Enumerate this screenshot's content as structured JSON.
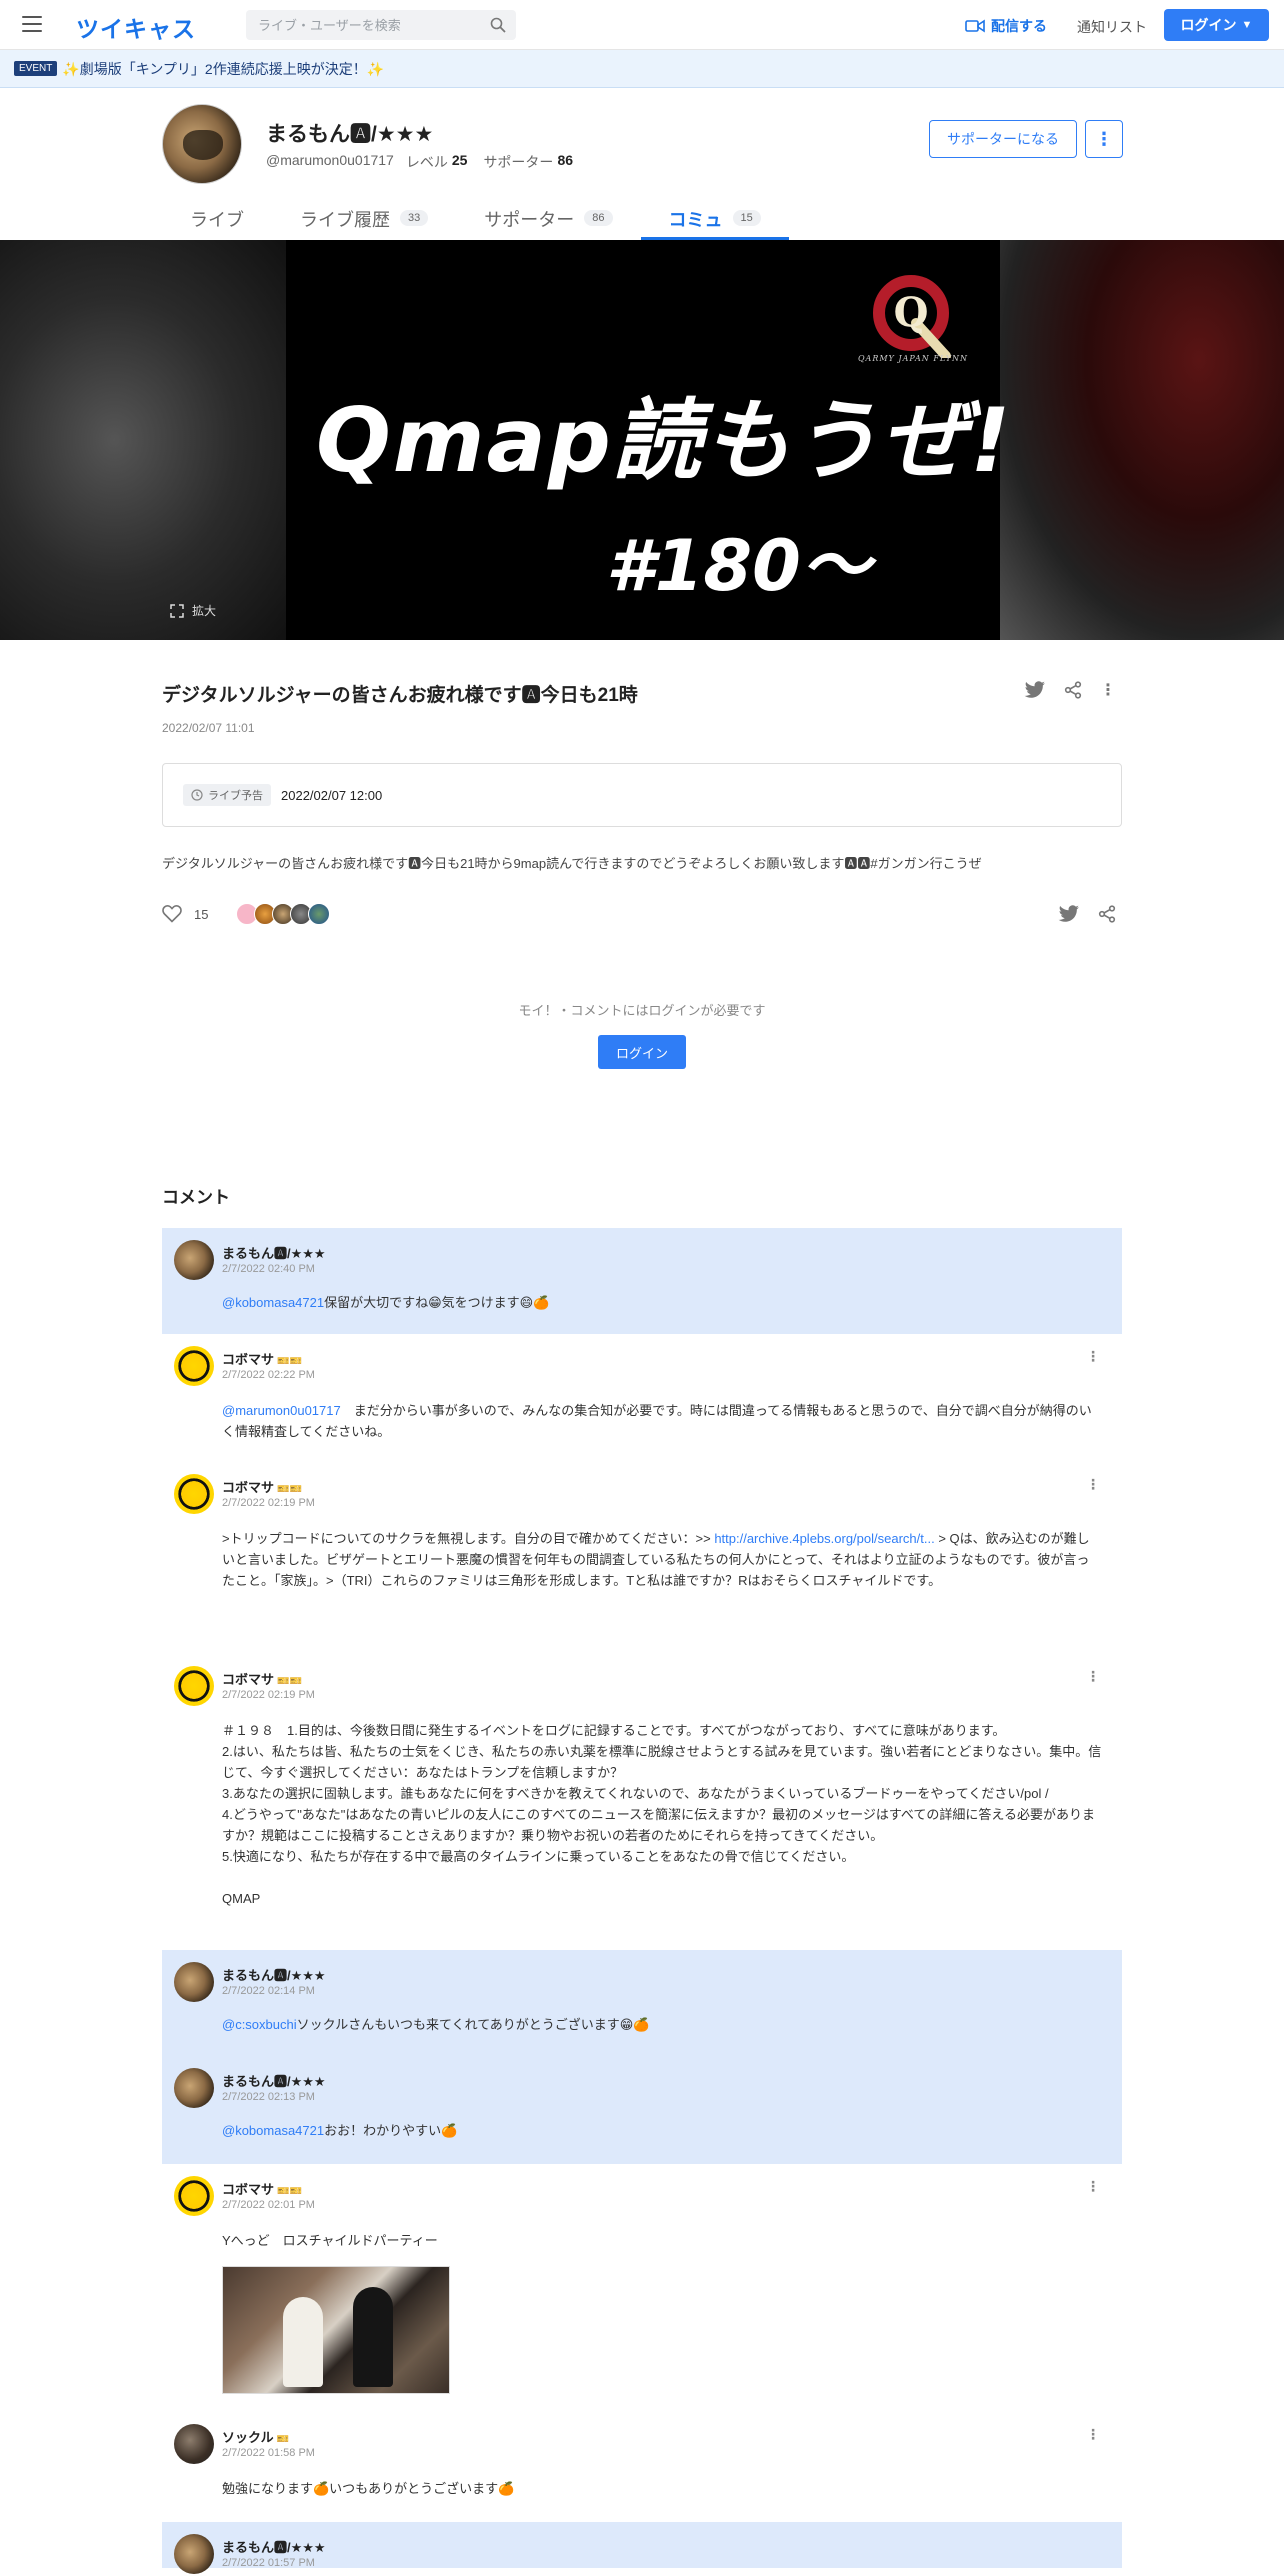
{
  "header": {
    "logo": "ツイキャス",
    "search_placeholder": "ライブ・ユーザーを検索",
    "broadcast_label": "配信する",
    "notify_label": "通知リスト",
    "login_label": "ログイン"
  },
  "event": {
    "tag": "EVENT",
    "text": "✨劇場版「キンプリ」2作連続応援上映が決定！✨"
  },
  "profile": {
    "name": "まるもん🅰/★★★",
    "user_id": "@marumon0u01717",
    "level_label": "レベル",
    "level": "25",
    "supporter_label": "サポーター",
    "supporter_count": "86",
    "supporter_button": "サポーターになる",
    "more_button": "⋮"
  },
  "tabs": [
    {
      "label": "ライブ",
      "count": ""
    },
    {
      "label": "ライブ履歴",
      "count": "33"
    },
    {
      "label": "サポーター",
      "count": "86"
    },
    {
      "label": "コミュ",
      "count": "15"
    }
  ],
  "banner": {
    "logo_letter": "Q",
    "logo_caption": "QARMY JAPAN FLYNN",
    "title": "Qmap読もうぜ!",
    "subtitle": "#180〜",
    "expand_label": "拡大"
  },
  "post": {
    "title": "デジタルソルジャーの皆さんお疲れ様です🅰今日も21時",
    "date": "2022/02/07 11:01",
    "schedule_tag": "ライブ予告",
    "schedule_time": "2022/02/07 12:00",
    "body": "デジタルソルジャーの皆さんお疲れ様です🅰今日も21時から9map読んで行きますのでどうぞよろしくお願い致します🅰🅰#ガンガン行こうぜ",
    "likes": "15",
    "login_note": "モイ！・コメントにはログインが必要です",
    "login_button": "ログイン"
  },
  "comments_heading": "コメント",
  "comments": [
    {
      "name": "まるもん🅰/★★★",
      "badge": "",
      "date": "2/7/2022 02:40 PM",
      "mention": "@kobomasa4721",
      "text": "保留が大切ですね😁気をつけます😄🍊"
    },
    {
      "name": "コボマサ",
      "badge": "🎫🎫",
      "date": "2/7/2022 02:22 PM",
      "mention": "@marumon0u01717",
      "text": "　まだ分からい事が多いので、みんなの集合知が必要です。時には間違ってる情報もあると思うので、自分で調べ自分が納得のいく情報精査してくださいね。"
    },
    {
      "name": "コボマサ",
      "badge": "🎫🎫",
      "date": "2/7/2022 02:19 PM",
      "mention": "",
      "text": ">トリップコードについてのサクラを無視します。自分の目で確かめてください：>> ",
      "link": "http://archive.4plebs.org/pol/search/t...",
      "text2": " > Qは、飲み込むのが難しいと言いました。ビザゲートとエリート悪魔の慣習を何年もの間調査している私たちの何人かにとって、それはより立証のようなものです。彼が言ったこと。「家族」。>（TRI）これらのファミリは三角形を形成します。Tと私は誰ですか？Rはおそらくロスチャイルドです。"
    },
    {
      "name": "コボマサ",
      "badge": "🎫🎫",
      "date": "2/7/2022 02:19 PM",
      "mention": "",
      "text": "＃１９８　1.目的は、今後数日間に発生するイベントをログに記録することです。すべてがつながっており、すべてに意味があります。\n2.はい、私たちは皆、私たちの士気をくじき、私たちの赤い丸薬を標準に脱線させようとする試みを見ています。強い若者にとどまりなさい。集中。信じて、今すぐ選択してください：あなたはトランプを信頼しますか？\n3.あなたの選択に固執します。誰もあなたに何をすべきかを教えてくれないので、あなたがうまくいっているブードゥーをやってください/pol /\n4.どうやって\"あなた\"はあなたの青いピルの友人にこのすべてのニュースを簡潔に伝えますか？最初のメッセージはすべての詳細に答える必要がありますか？規範はここに投稿することさえありますか？乗り物やお祝いの若者のためにそれらを持ってきてください。\n5.快適になり、私たちが存在する中で最高のタイムラインに乗っていることをあなたの骨で信じてください。\n\nQMAP"
    },
    {
      "name": "まるもん🅰/★★★",
      "badge": "",
      "date": "2/7/2022 02:14 PM",
      "mention": "@c:soxbuchi",
      "text": "ソックルさんもいつも来てくれてありがとうございます😁🍊"
    },
    {
      "name": "まるもん🅰/★★★",
      "badge": "",
      "date": "2/7/2022 02:13 PM",
      "mention": "@kobomasa4721",
      "text": "おお！わかりやすい🍊"
    },
    {
      "name": "コボマサ",
      "badge": "🎫🎫",
      "date": "2/7/2022 02:01 PM",
      "mention": "",
      "text": "Yへっど　ロスチャイルドパーティー"
    },
    {
      "name": "ソックル",
      "badge": "🎫",
      "date": "2/7/2022 01:58 PM",
      "mention": "",
      "text": "勉強になります🍊いつもありがとうございます🍊"
    },
    {
      "name": "まるもん🅰/★★★",
      "badge": "",
      "date": "2/7/2022 01:57 PM",
      "mention": "",
      "text": ""
    }
  ],
  "icons": {
    "menu": "hamburger-icon",
    "search": "search-icon",
    "camera": "video-camera-icon",
    "twitter": "twitter-icon",
    "share": "share-icon",
    "heart": "heart-icon",
    "clock": "clock-icon",
    "expand": "expand-icon"
  },
  "colors": {
    "accent": "#2f7df6",
    "brand": "#1a73e8",
    "highlight_bg": "#dde9fb"
  }
}
